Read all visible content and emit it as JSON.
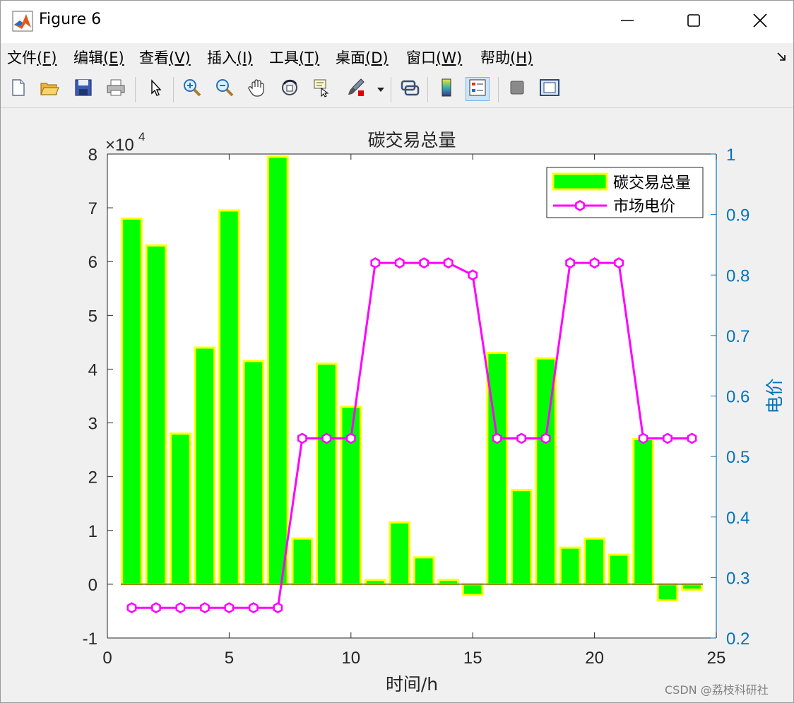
{
  "window": {
    "title": "Figure 6",
    "minimize_label": "minimize",
    "maximize_label": "maximize",
    "close_label": "close"
  },
  "menu": [
    {
      "label": "文件",
      "hotkey": "(F)"
    },
    {
      "label": "编辑",
      "hotkey": "(E)"
    },
    {
      "label": "查看",
      "hotkey": "(V)"
    },
    {
      "label": "插入",
      "hotkey": "(I)"
    },
    {
      "label": "工具",
      "hotkey": "(T)"
    },
    {
      "label": "桌面",
      "hotkey": "(D)"
    },
    {
      "label": "窗口",
      "hotkey": "(W)"
    },
    {
      "label": "帮助",
      "hotkey": "(H)"
    }
  ],
  "toolbar": {
    "icons": [
      "new-file-icon",
      "open-folder-icon",
      "save-icon",
      "print-icon",
      "pointer-icon",
      "zoom-in-icon",
      "zoom-out-icon",
      "pan-hand-icon",
      "rotate-3d-icon",
      "data-cursor-icon",
      "brush-icon",
      "brush-dropdown-icon",
      "link-plot-icon",
      "colorbar-icon",
      "legend-icon",
      "hide-plot-tools-icon",
      "show-plot-tools-icon"
    ]
  },
  "colors": {
    "bar_fill": "#00ff00",
    "bar_edge": "#ffff00",
    "line": "#ff00ff",
    "right_axis": "#0072bd",
    "axis": "#262626"
  },
  "chart_data": {
    "type": "bar",
    "title": "碳交易总量",
    "xlabel": "时间/h",
    "ylabel_left": "",
    "ylabel_right": "电价",
    "left_exponent_label": "×10",
    "left_exponent_power": "4",
    "xlim": [
      0,
      25
    ],
    "ylim_left": [
      -1,
      8
    ],
    "ylim_right": [
      0.2,
      1
    ],
    "x_ticks": [
      0,
      5,
      10,
      15,
      20,
      25
    ],
    "y_ticks_left": [
      -1,
      0,
      1,
      2,
      3,
      4,
      5,
      6,
      7,
      8
    ],
    "y_ticks_right": [
      0.2,
      0.3,
      0.4,
      0.5,
      0.6,
      0.7,
      0.8,
      0.9,
      1
    ],
    "y_tick_labels_right": [
      "0.2",
      "0.3",
      "0.4",
      "0.5",
      "0.6",
      "0.7",
      "0.8",
      "0.9",
      "1"
    ],
    "x": [
      1,
      2,
      3,
      4,
      5,
      6,
      7,
      8,
      9,
      10,
      11,
      12,
      13,
      14,
      15,
      16,
      17,
      18,
      19,
      20,
      21,
      22,
      23,
      24
    ],
    "series": [
      {
        "name": "碳交易总量",
        "kind": "bar",
        "axis": "left",
        "values": [
          6.8,
          6.3,
          2.8,
          4.4,
          6.95,
          4.15,
          7.95,
          0.85,
          4.1,
          3.3,
          0.08,
          1.15,
          0.5,
          0.08,
          -0.2,
          4.3,
          1.75,
          4.2,
          0.68,
          0.85,
          0.55,
          2.7,
          -0.3,
          -0.1
        ]
      },
      {
        "name": "市场电价",
        "kind": "line",
        "axis": "right",
        "values": [
          0.25,
          0.25,
          0.25,
          0.25,
          0.25,
          0.25,
          0.25,
          0.53,
          0.53,
          0.53,
          0.82,
          0.82,
          0.82,
          0.82,
          0.8,
          0.53,
          0.53,
          0.53,
          0.82,
          0.82,
          0.82,
          0.53,
          0.53,
          0.53
        ]
      }
    ],
    "legend_position": "top-right"
  },
  "watermark": "CSDN @荔枝科研社"
}
